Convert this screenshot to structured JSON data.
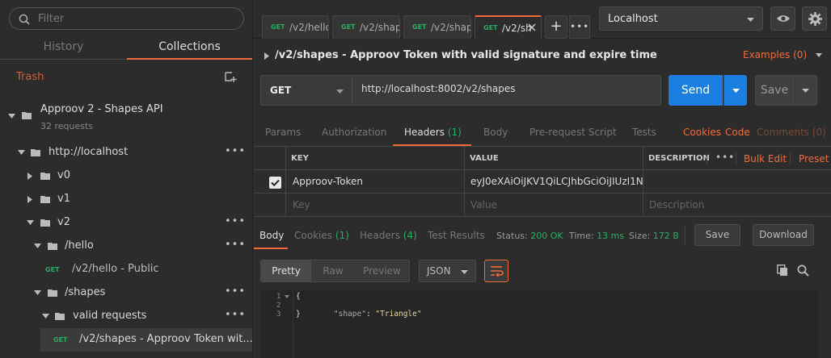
{
  "sidebar": {
    "filter_placeholder": "Filter",
    "tabs": {
      "history": "History",
      "collections": "Collections"
    },
    "trash": "Trash",
    "collection": {
      "name": "Approov 2 - Shapes API",
      "count": "32 requests"
    },
    "tree": {
      "localhost": "http://localhost",
      "v0": "v0",
      "v1": "v1",
      "v2": "v2",
      "hello": "/hello",
      "hello_get_method": "GET",
      "hello_get": "/v2/hello - Public",
      "shapes": "/shapes",
      "valid": "valid requests",
      "shapes_get_method": "GET",
      "shapes_get": "/v2/shapes - Approov Token wit..."
    }
  },
  "topbar": {
    "tabs": [
      {
        "method": "GET",
        "label": "/v2/hello -"
      },
      {
        "method": "GET",
        "label": "/v2/shape"
      },
      {
        "method": "GET",
        "label": "/v2/shape"
      },
      {
        "method": "GET",
        "label": "/v2/sh"
      }
    ],
    "plus": "+",
    "more": "•••",
    "environment": "Localhost"
  },
  "request": {
    "title": "/v2/shapes - Approov Token with valid signature and expire time",
    "examples": "Examples (0)",
    "method": "GET",
    "url": "http://localhost:8002/v2/shapes",
    "send": "Send",
    "save": "Save",
    "tabs": {
      "params": "Params",
      "authorization": "Authorization",
      "headers": "Headers",
      "headers_count": "(1)",
      "body": "Body",
      "prerequest": "Pre-request Script",
      "tests": "Tests",
      "cookies": "Cookies",
      "code": "Code",
      "comments": "Comments (0)"
    }
  },
  "headers_table": {
    "columns": {
      "key": "KEY",
      "value": "VALUE",
      "description": "DESCRIPTION"
    },
    "more": "•••",
    "bulk_edit": "Bulk Edit",
    "presets": "Preset",
    "rows": [
      {
        "key": "Approov-Token",
        "value": "eyJ0eXAiOiJKV1QiLCJhbGciOiJIUzI1Ni...",
        "description": ""
      }
    ],
    "placeholder": {
      "key": "Key",
      "value": "Value",
      "description": "Description"
    }
  },
  "response": {
    "tabs": {
      "body": "Body",
      "cookies": "Cookies",
      "cookies_count": "(1)",
      "headers": "Headers",
      "headers_count": "(4)",
      "tests": "Test Results"
    },
    "status_label": "Status:",
    "status_value": "200 OK",
    "time_label": "Time:",
    "time_value": "13 ms",
    "size_label": "Size:",
    "size_value": "172 B",
    "save": "Save",
    "download": "Download",
    "format_buttons": {
      "pretty": "Pretty",
      "raw": "Raw",
      "preview": "Preview"
    },
    "format_select": "JSON",
    "code_lines": {
      "l1": "{",
      "l2_key": "\"shape\"",
      "l2_sep": ": ",
      "l2_val": "\"Triangle\"",
      "l3": "}"
    },
    "line_numbers": [
      "1",
      "2",
      "3"
    ]
  },
  "colors": {
    "accent": "#f26b3a",
    "send": "#1a7fe0",
    "get_method": "#27ae60",
    "background": "#2c2c2c"
  }
}
